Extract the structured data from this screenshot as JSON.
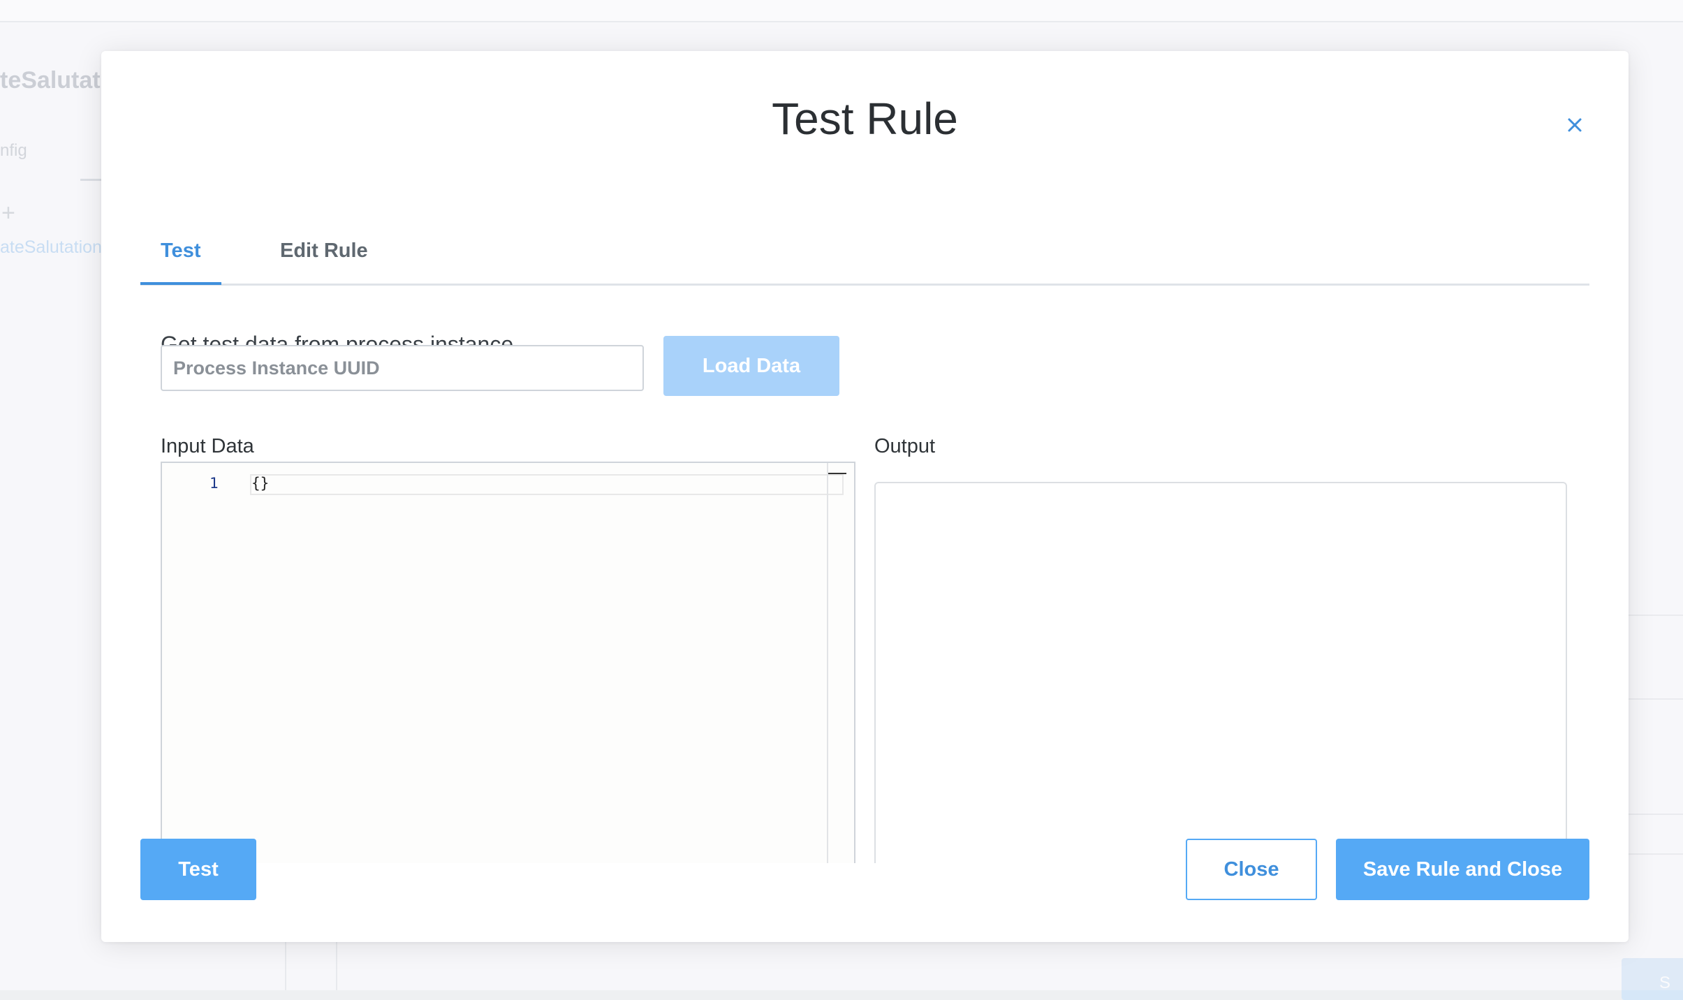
{
  "background": {
    "title": "teSalutat",
    "tab": "nfig",
    "plus": "+",
    "item": "ateSalutation",
    "corner_button": "S"
  },
  "modal": {
    "title": "Test Rule",
    "close_icon": "×",
    "tabs": [
      {
        "label": "Test",
        "active": true
      },
      {
        "label": "Edit Rule",
        "active": false
      }
    ],
    "section_label": "Get test data from process instance",
    "uuid_input": {
      "value": "",
      "placeholder": "Process Instance UUID"
    },
    "load_button": "Load Data",
    "input_data": {
      "label": "Input Data",
      "line_number": "1",
      "code": "{}"
    },
    "output": {
      "label": "Output",
      "value": ""
    },
    "buttons": {
      "test": "Test",
      "close": "Close",
      "save": "Save Rule and Close"
    }
  },
  "colors": {
    "accent": "#3f8fdc",
    "primary_button": "#55a9f5",
    "disabled_button": "#a9d2fa"
  }
}
